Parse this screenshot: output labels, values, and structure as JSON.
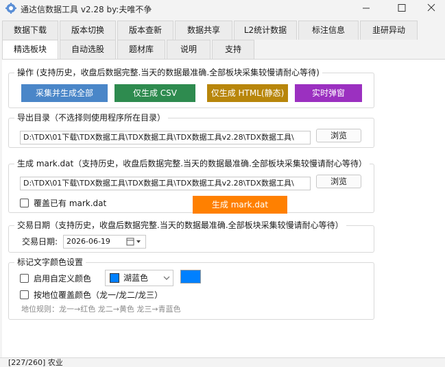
{
  "window": {
    "title": "通达信数据工具 v2.28 by:夫唯不争"
  },
  "tabs_row1": [
    "数据下载",
    "版本切换",
    "版本查新",
    "数据共享",
    "L2统计数据",
    "标注信息",
    "韭研异动"
  ],
  "tabs_row2": [
    "精选板块",
    "自动选股",
    "题材库",
    "说明",
    "支持"
  ],
  "ops": {
    "title": "操作 (支持历史，收盘后数据完整.当天的数据最准确.全部板块采集较慢请耐心等待)",
    "btn_collect_all": "采集并生成全部",
    "btn_csv": "仅生成 CSV",
    "btn_html": "仅生成 HTML(静态)",
    "btn_popup": "实时弹窗",
    "colors": {
      "collect": "#4a86c8",
      "csv": "#2e8b4f",
      "html": "#b8860b",
      "popup": "#9b30c0"
    }
  },
  "export": {
    "title": "导出目录（不选择则使用程序所在目录）",
    "path": "D:\\TDX\\01下载\\TDX数据工具\\TDX数据工具\\TDX数据工具v2.28\\TDX数据工具\\",
    "browse": "浏览"
  },
  "mark": {
    "title": "生成 mark.dat（支持历史，收盘后数据完整.当天的数据最准确.全部板块采集较慢请耐心等待）",
    "path": "D:\\TDX\\01下载\\TDX数据工具\\TDX数据工具\\TDX数据工具v2.28\\TDX数据工具\\",
    "browse": "浏览",
    "overwrite_label": "覆盖已有 mark.dat",
    "generate": "生成 mark.dat",
    "generate_color": "#ff8000"
  },
  "trade": {
    "title": "交易日期（支持历史，收盘后数据完整.当天的数据最准确.全部板块采集较慢请耐心等待）",
    "date_label": "交易日期:",
    "date_value": "2026-06-19"
  },
  "colorset": {
    "title": "标记文字颜色设置",
    "custom_label": "启用自定义颜色",
    "color_name": "湖蓝色",
    "color_hex": "#0080ff",
    "override_label": "按地位覆盖颜色（龙一/龙二/龙三）",
    "rule_text": "地位规则：龙一→红色  龙二→黄色  龙三→青蓝色"
  },
  "status": {
    "text": "[227/260] 农业"
  }
}
